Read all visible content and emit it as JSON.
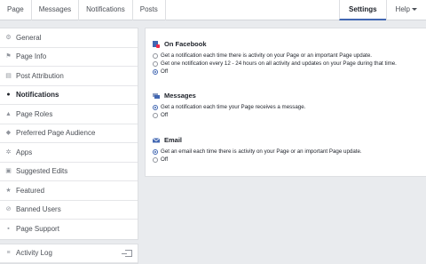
{
  "top_nav": {
    "left_tabs": [
      "Page",
      "Messages",
      "Notifications",
      "Posts"
    ],
    "settings_label": "Settings",
    "help_label": "Help"
  },
  "sidebar": {
    "items": [
      {
        "label": "General",
        "icon": "gear-icon"
      },
      {
        "label": "Page Info",
        "icon": "flag-icon"
      },
      {
        "label": "Post Attribution",
        "icon": "post-icon"
      },
      {
        "label": "Notifications",
        "icon": "globe-icon",
        "active": true
      },
      {
        "label": "Page Roles",
        "icon": "person-icon"
      },
      {
        "label": "Preferred Page Audience",
        "icon": "audience-icon"
      },
      {
        "label": "Apps",
        "icon": "apps-icon"
      },
      {
        "label": "Suggested Edits",
        "icon": "edit-icon"
      },
      {
        "label": "Featured",
        "icon": "star-icon"
      },
      {
        "label": "Banned Users",
        "icon": "banned-icon"
      },
      {
        "label": "Page Support",
        "icon": "support-icon"
      }
    ],
    "activity_log": "Activity Log"
  },
  "settings": {
    "on_facebook": {
      "title": "On Facebook",
      "options": [
        "Get a notification each time there is activity on your Page or an important Page update.",
        "Get one notification every 12 - 24 hours on all activity and updates on your Page during that time.",
        "Off"
      ],
      "selected": 2
    },
    "messages": {
      "title": "Messages",
      "options": [
        "Get a notification each time your Page receives a message.",
        "Off"
      ],
      "selected": 0
    },
    "email": {
      "title": "Email",
      "options": [
        "Get an email each time there is activity on your Page or an important Page update.",
        "Off"
      ],
      "selected": 0
    }
  },
  "colors": {
    "accent": "#4267b2",
    "background": "#e9ebee"
  }
}
